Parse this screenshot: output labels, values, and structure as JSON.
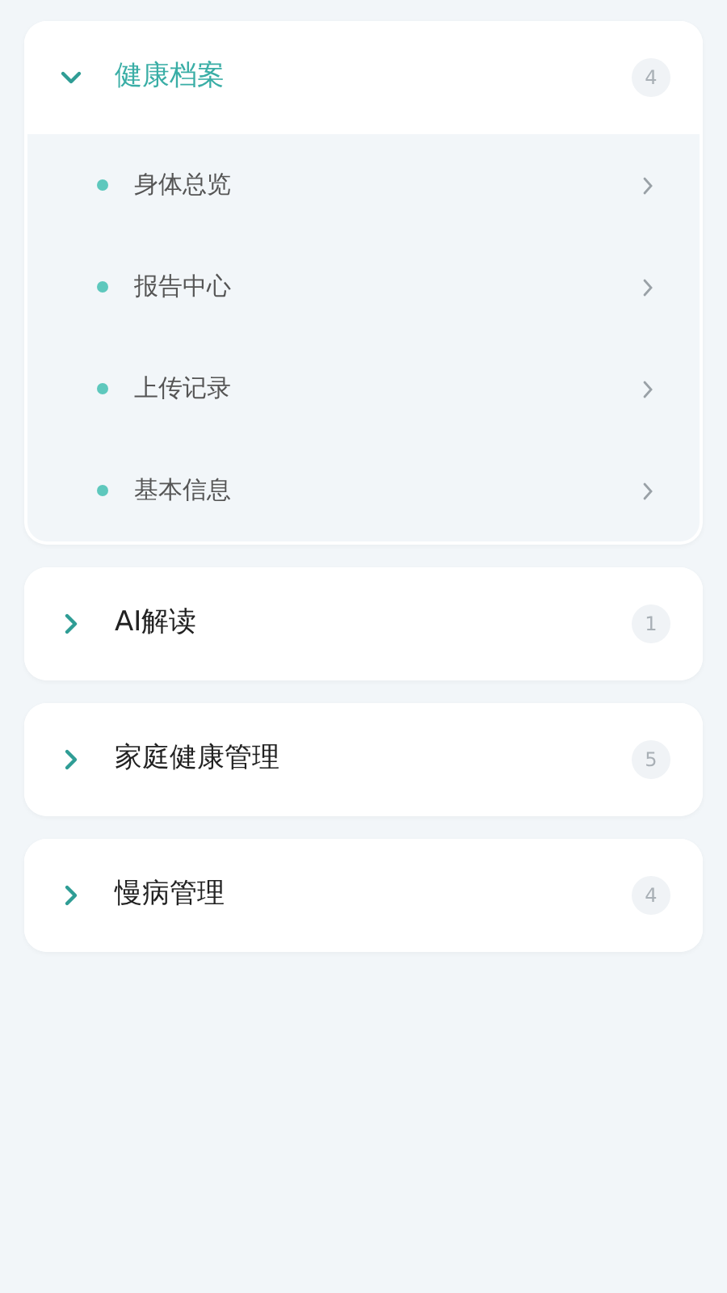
{
  "sections": [
    {
      "title": "健康档案",
      "count": "4",
      "expanded": true,
      "items": [
        {
          "label": "身体总览"
        },
        {
          "label": "报告中心"
        },
        {
          "label": "上传记录"
        },
        {
          "label": "基本信息"
        }
      ]
    },
    {
      "title": "AI解读",
      "count": "1",
      "expanded": false
    },
    {
      "title": "家庭健康管理",
      "count": "5",
      "expanded": false
    },
    {
      "title": "慢病管理",
      "count": "4",
      "expanded": false
    }
  ]
}
